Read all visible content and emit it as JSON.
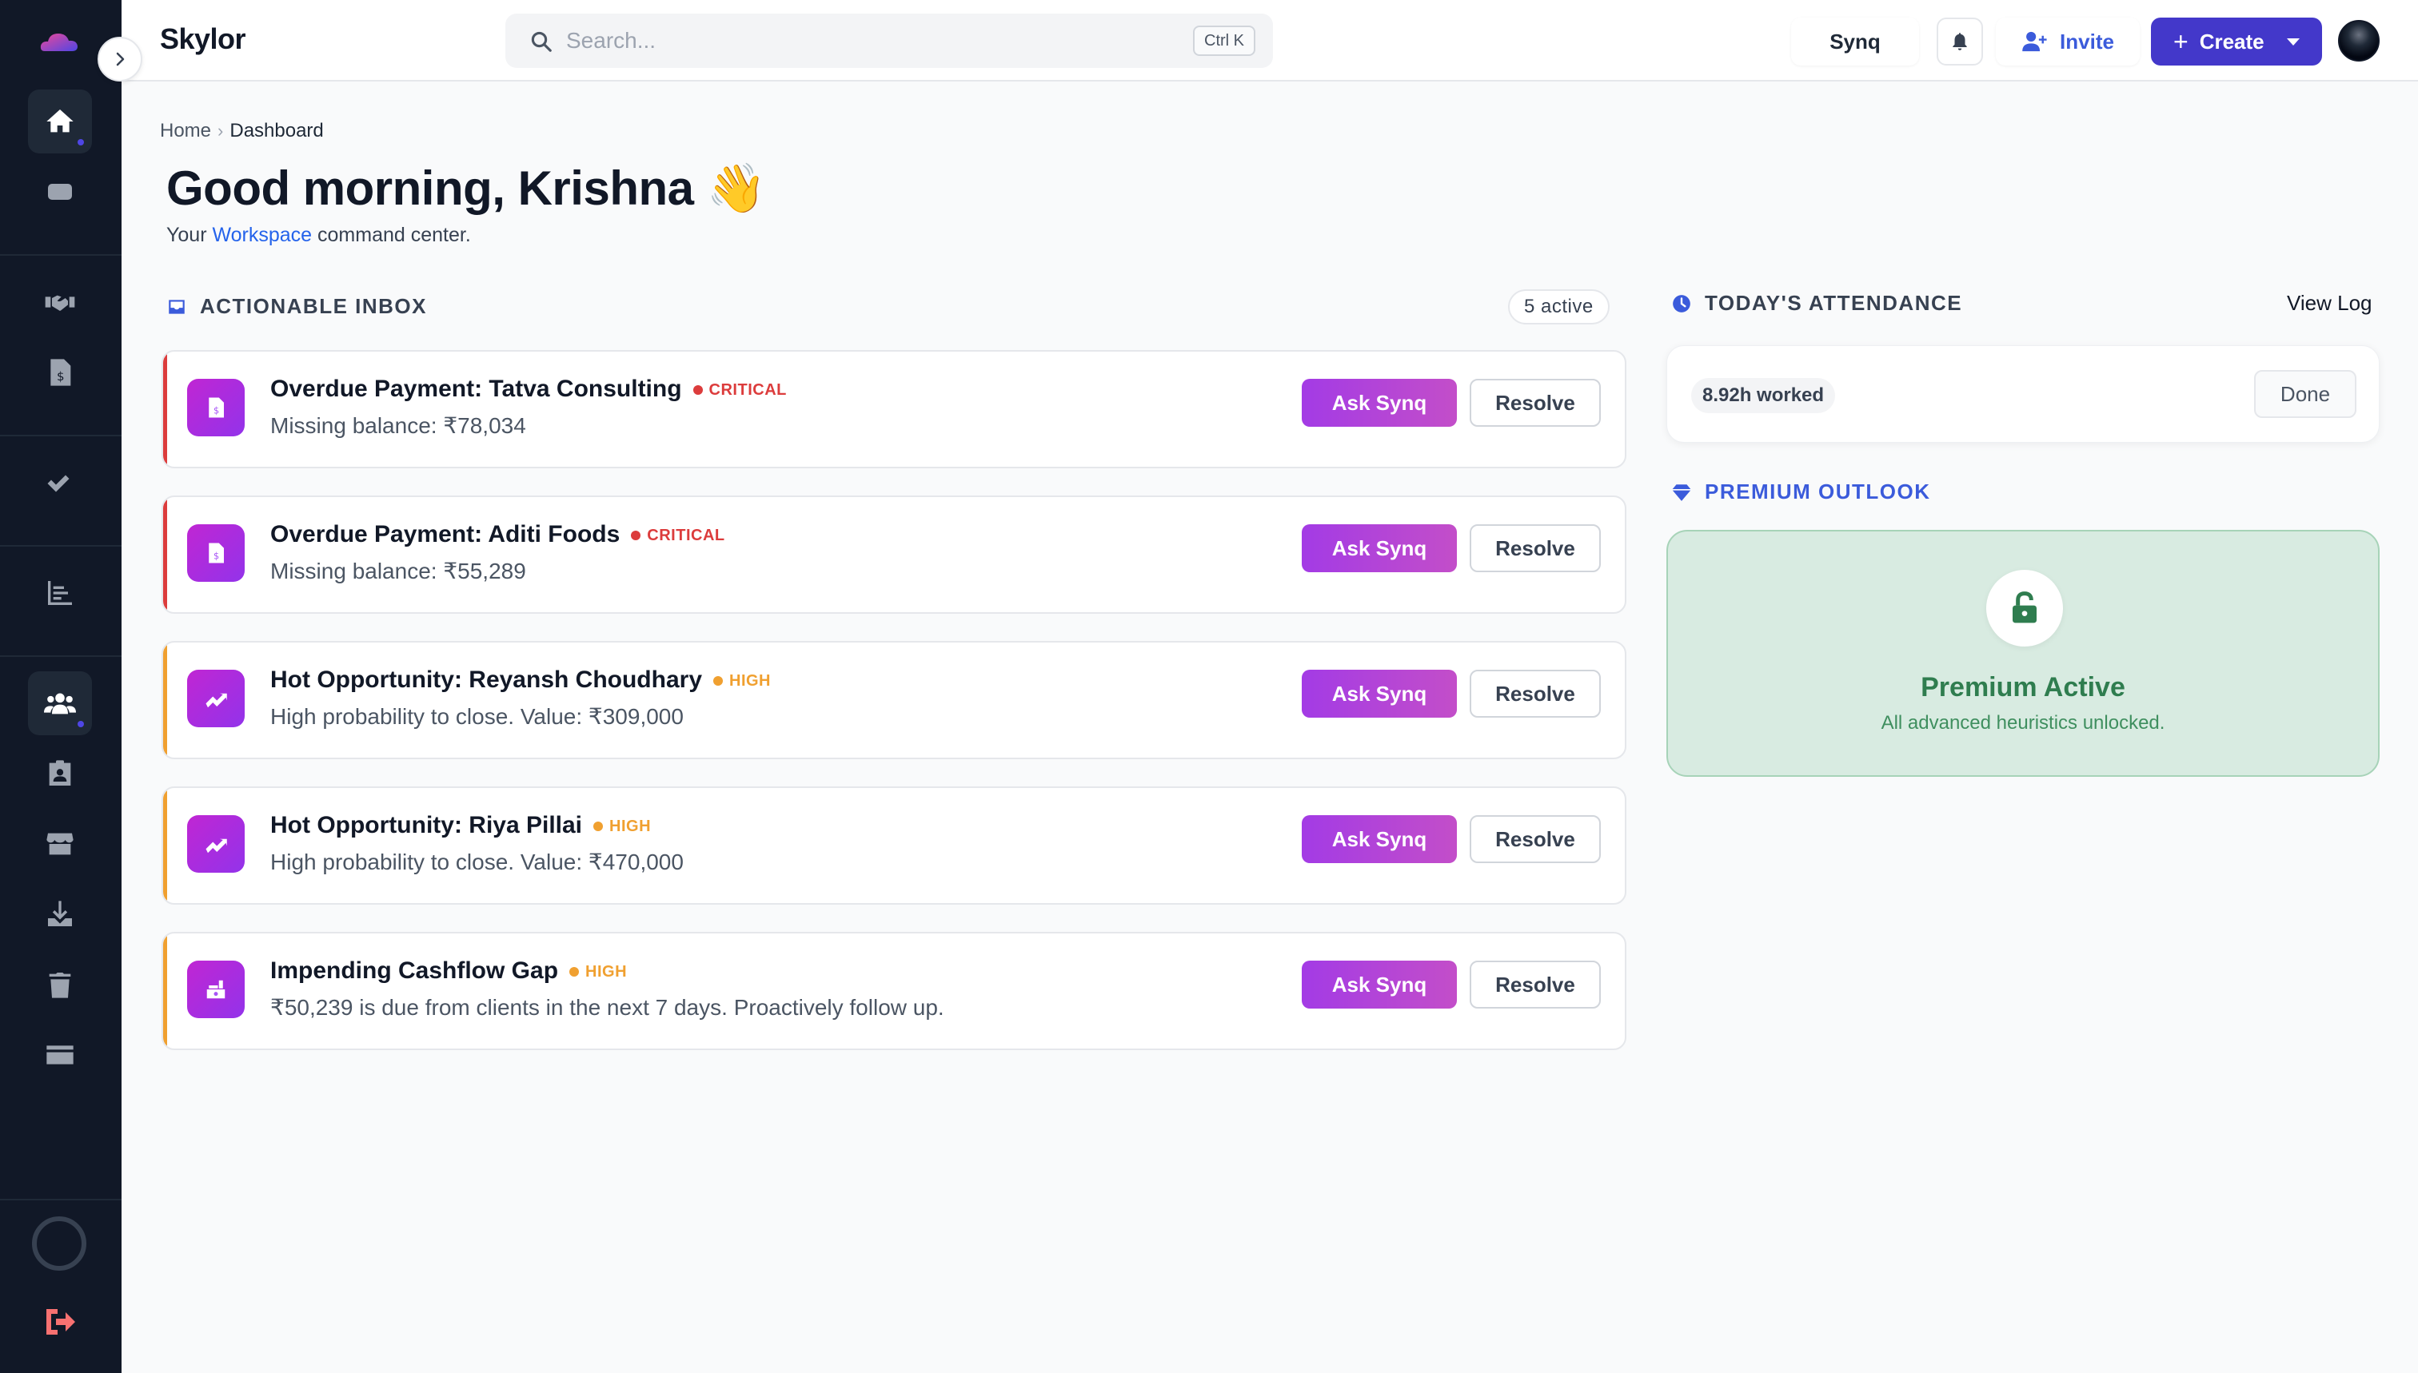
{
  "app": {
    "brand": "Skylor"
  },
  "search": {
    "placeholder": "Search...",
    "shortcut": "Ctrl K"
  },
  "topbar": {
    "synq_label": "Synq",
    "invite_label": "Invite",
    "create_label": "Create"
  },
  "sidebar": {
    "items": [
      {
        "name": "home",
        "icon": "home-icon",
        "active": true
      },
      {
        "name": "inbox",
        "icon": "tray-icon",
        "active": false
      },
      {
        "name": "deals",
        "icon": "handshake-icon",
        "active": false
      },
      {
        "name": "invoices",
        "icon": "invoice-icon",
        "active": false
      },
      {
        "name": "tasks",
        "icon": "check-double-icon",
        "active": false
      },
      {
        "name": "reports",
        "icon": "bar-chart-icon",
        "active": false
      },
      {
        "name": "people",
        "icon": "users-icon",
        "active": true
      },
      {
        "name": "contacts",
        "icon": "id-badge-icon",
        "active": false
      },
      {
        "name": "store",
        "icon": "store-icon",
        "active": false
      },
      {
        "name": "downloads",
        "icon": "download-icon",
        "active": false
      },
      {
        "name": "trash",
        "icon": "trash-icon",
        "active": false
      },
      {
        "name": "billing",
        "icon": "credit-card-icon",
        "active": false
      }
    ]
  },
  "breadcrumb": {
    "home": "Home",
    "current": "Dashboard"
  },
  "greeting": {
    "text": "Good morning, Krishna",
    "emoji": "👋"
  },
  "subtitle": {
    "prefix": "Your",
    "workspace": "Workspace",
    "suffix": "command center."
  },
  "inbox": {
    "heading": "ACTIONABLE INBOX",
    "count": "5 active",
    "items": [
      {
        "title": "Overdue Payment: Tatva Consulting",
        "priority": "CRITICAL",
        "description": "Missing balance: ₹78,034",
        "icon": "invoice-dollar-icon",
        "ask": "Ask Synq",
        "resolve": "Resolve"
      },
      {
        "title": "Overdue Payment: Aditi Foods",
        "priority": "CRITICAL",
        "description": "Missing balance: ₹55,289",
        "icon": "invoice-dollar-icon",
        "ask": "Ask Synq",
        "resolve": "Resolve"
      },
      {
        "title": "Hot Opportunity: Reyansh Choudhary",
        "priority": "HIGH",
        "description": "High probability to close. Value: ₹309,000",
        "icon": "trend-up-icon",
        "ask": "Ask Synq",
        "resolve": "Resolve"
      },
      {
        "title": "Hot Opportunity: Riya Pillai",
        "priority": "HIGH",
        "description": "High probability to close. Value: ₹470,000",
        "icon": "trend-up-icon",
        "ask": "Ask Synq",
        "resolve": "Resolve"
      },
      {
        "title": "Impending Cashflow Gap",
        "priority": "HIGH",
        "description": "₹50,239 is due from clients in the next 7 days. Proactively follow up.",
        "icon": "cash-register-icon",
        "ask": "Ask Synq",
        "resolve": "Resolve"
      }
    ]
  },
  "attendance": {
    "heading": "TODAY'S ATTENDANCE",
    "view_log": "View Log",
    "worked": "8.92h worked",
    "done": "Done"
  },
  "premium": {
    "heading": "PREMIUM OUTLOOK",
    "title": "Premium Active",
    "subtitle": "All advanced heuristics unlocked."
  },
  "colors": {
    "critical": "#dc3c3c",
    "high": "#f0a030",
    "accent_purple": "#b247d8",
    "primary": "#4338ca",
    "link": "#2563eb",
    "premium_green": "#2f7d4f"
  }
}
